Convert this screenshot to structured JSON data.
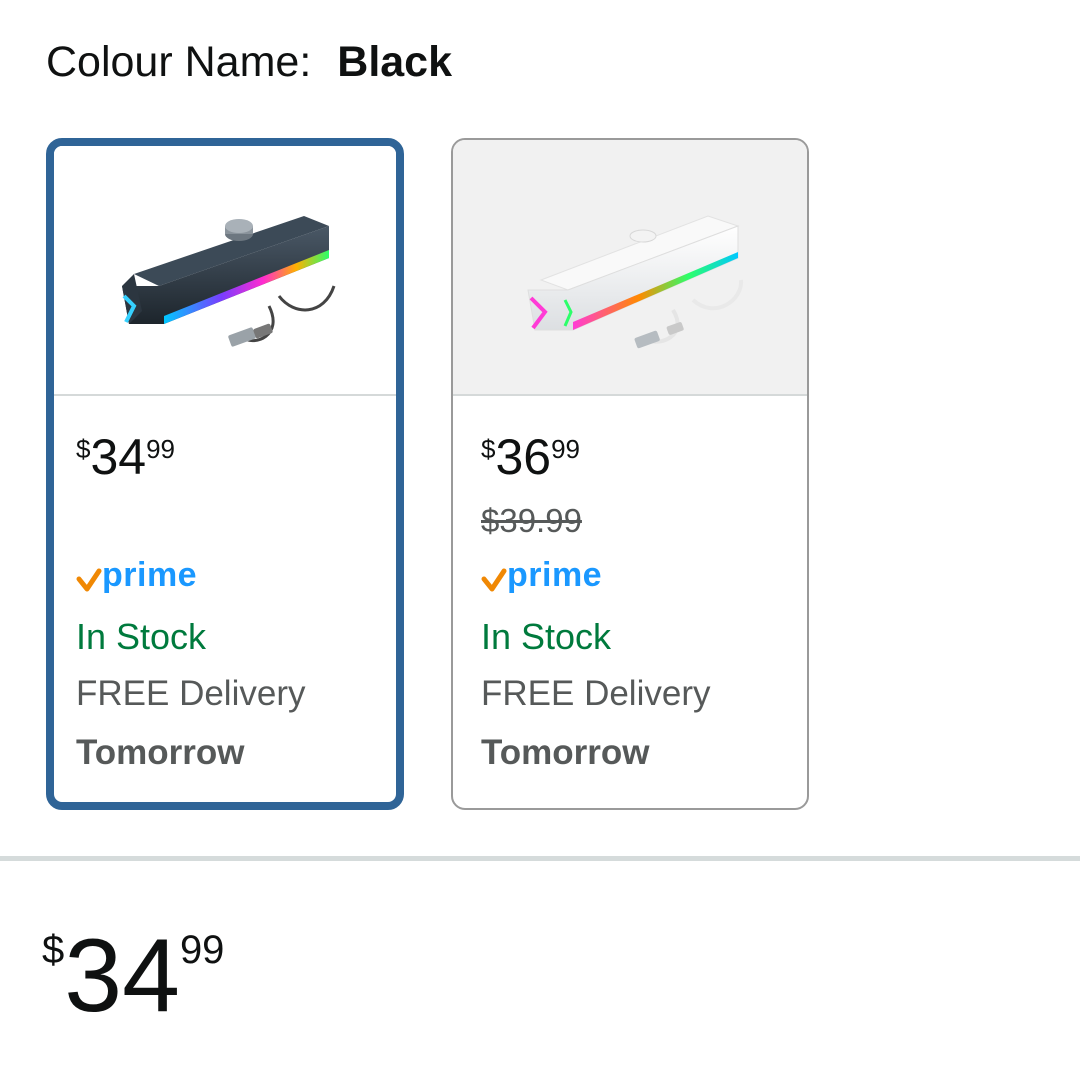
{
  "colour": {
    "label": "Colour Name:",
    "value": "Black"
  },
  "variants": [
    {
      "selected": true,
      "image_icon": "black-rgb-soundbar",
      "price": {
        "symbol": "$",
        "whole": "34",
        "fraction": "99"
      },
      "was_price": "",
      "prime_label": "prime",
      "stock": "In Stock",
      "delivery": "FREE Delivery",
      "delivery_day": "Tomorrow"
    },
    {
      "selected": false,
      "image_icon": "white-rgb-soundbar",
      "price": {
        "symbol": "$",
        "whole": "36",
        "fraction": "99"
      },
      "was_price": "$39.99",
      "prime_label": "prime",
      "stock": "In Stock",
      "delivery": "FREE Delivery",
      "delivery_day": "Tomorrow"
    }
  ],
  "current_price": {
    "symbol": "$",
    "whole": "34",
    "fraction": "99"
  },
  "colors": {
    "selected_border": "#2f6497",
    "unselected_border": "#9a9a9a",
    "stock_green": "#007a3d",
    "prime_blue": "#1a98ff",
    "prime_check_orange": "#f08804"
  }
}
